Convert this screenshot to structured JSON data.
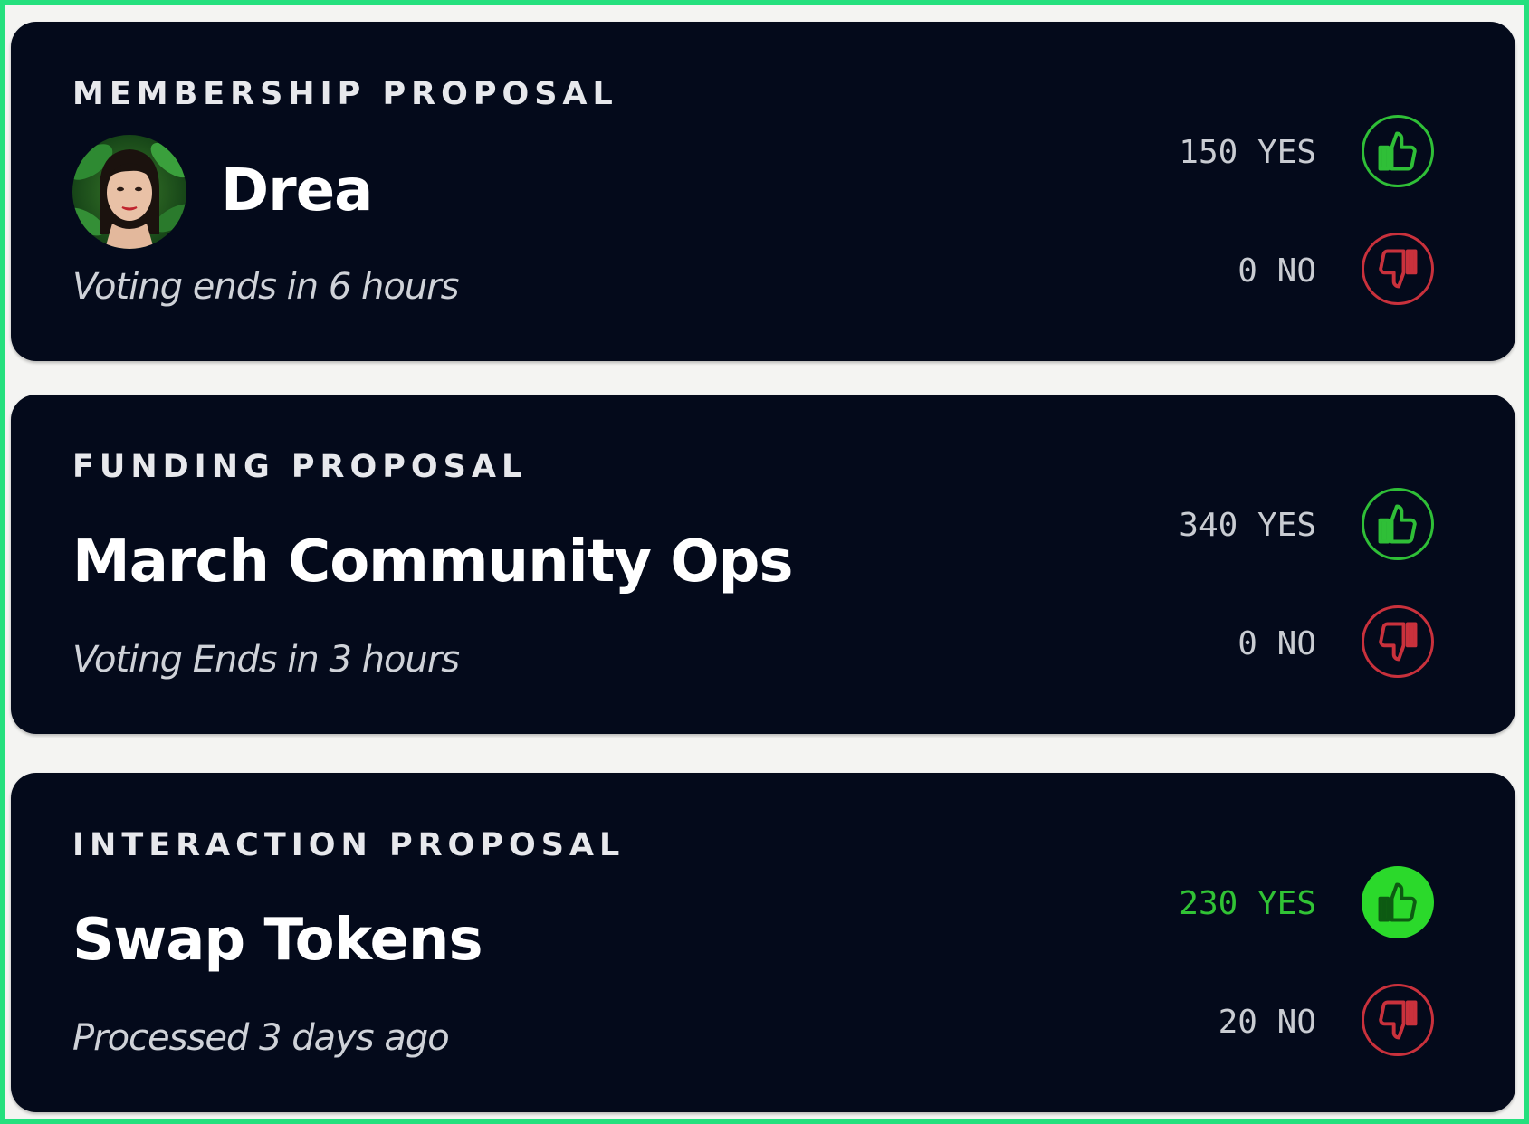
{
  "proposals": [
    {
      "type": "MEMBERSHIP PROPOSAL",
      "title": "Drea",
      "status": "Voting ends in 6 hours",
      "yes_label": "150 YES",
      "no_label": "0 NO",
      "has_avatar": true,
      "voted_yes": false
    },
    {
      "type": "FUNDING PROPOSAL",
      "title": "March Community Ops",
      "status": "Voting Ends in 3 hours",
      "yes_label": "340 YES",
      "no_label": "0 NO",
      "has_avatar": false,
      "voted_yes": false
    },
    {
      "type": "INTERACTION PROPOSAL",
      "title": "Swap Tokens",
      "status": "Processed 3 days ago",
      "yes_label": "230 YES",
      "no_label": "20 NO",
      "has_avatar": false,
      "voted_yes": true
    }
  ],
  "icons": {
    "yes": "thumbs-up-icon",
    "no": "thumbs-down-icon"
  },
  "colors": {
    "frame": "#25e07e",
    "card": "#040a1b",
    "yes": "#2fbf37",
    "no": "#c9313c",
    "yes_filled": "#2bd92b"
  }
}
